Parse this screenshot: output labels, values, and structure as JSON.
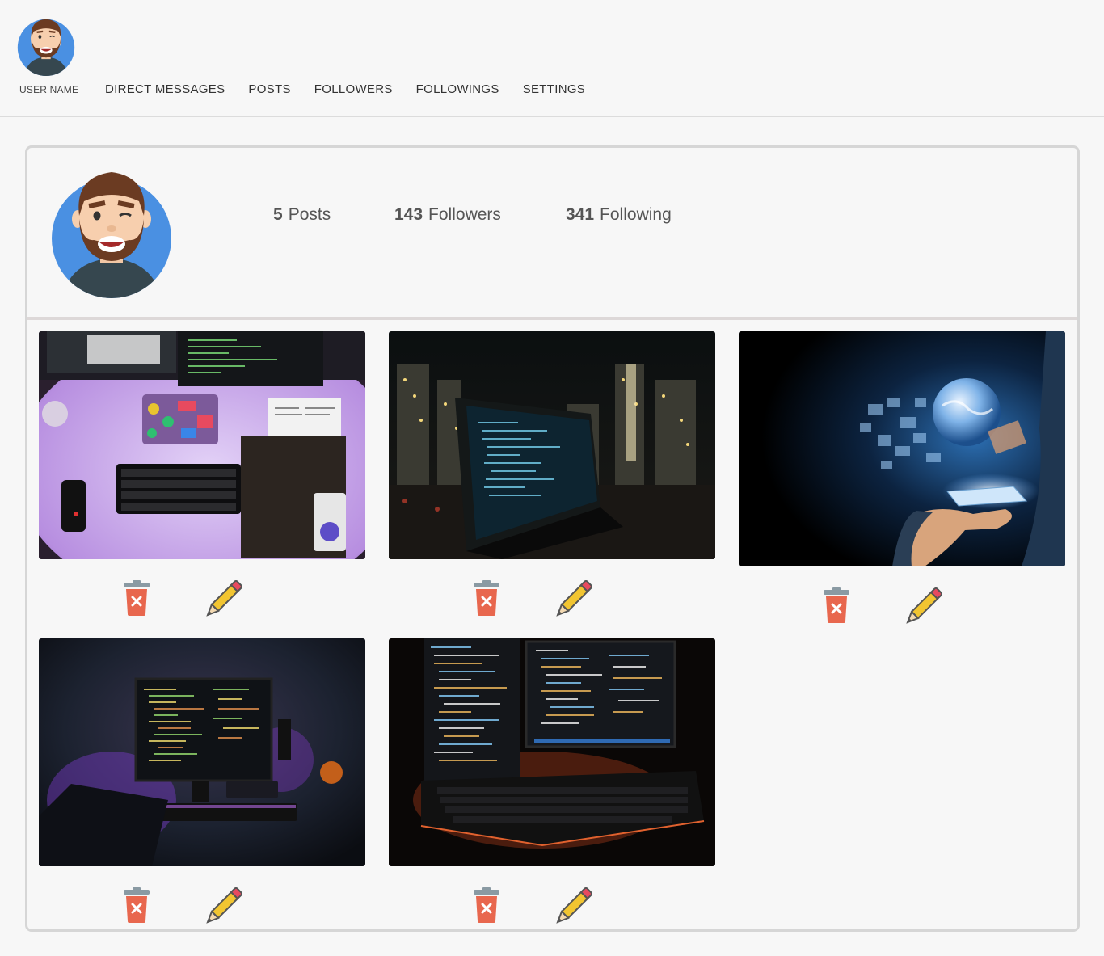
{
  "nav": {
    "username": "USER NAME",
    "links": [
      "DIRECT MESSAGES",
      "POSTS",
      "FOLLOWERS",
      "FOLLOWINGS",
      "SETTINGS"
    ]
  },
  "profile": {
    "stats": [
      {
        "count": "5",
        "label": "Posts"
      },
      {
        "count": "143",
        "label": "Followers"
      },
      {
        "count": "341",
        "label": "Following"
      }
    ]
  },
  "posts": [
    {
      "image": "purple-desk-setup-photo"
    },
    {
      "image": "laptop-city-night-photo"
    },
    {
      "image": "hand-globe-tablet-photo"
    },
    {
      "image": "dark-monitor-code-photo"
    },
    {
      "image": "dual-monitor-keyboard-photo"
    }
  ],
  "icons": {
    "delete": "trash-icon",
    "edit": "pencil-icon"
  },
  "colors": {
    "avatar_bg": "#4a90e2",
    "trash": "#e8674e",
    "pencil": "#f2c531"
  }
}
